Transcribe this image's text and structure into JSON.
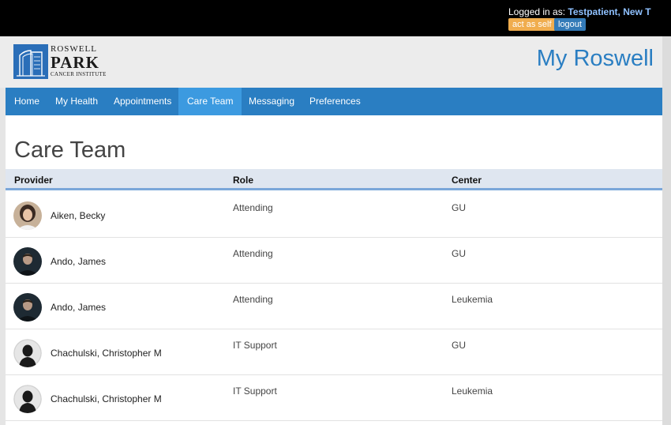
{
  "topbar": {
    "logged_in_label": "Logged in as:",
    "user_name": "Testpatient, New T",
    "act_as_self_label": "act as self",
    "logout_label": "logout"
  },
  "header": {
    "logo_line1": "ROSWELL",
    "logo_line2": "PARK",
    "logo_line3": "CANCER INSTITUTE",
    "site_title": "My Roswell"
  },
  "nav": {
    "items": [
      {
        "label": "Home"
      },
      {
        "label": "My Health"
      },
      {
        "label": "Appointments"
      },
      {
        "label": "Care Team",
        "active": true
      },
      {
        "label": "Messaging"
      },
      {
        "label": "Preferences"
      }
    ]
  },
  "main": {
    "title": "Care Team",
    "columns": [
      "Provider",
      "Role",
      "Center"
    ],
    "rows": [
      {
        "provider": "Aiken, Becky",
        "role": "Attending",
        "center": "GU",
        "avatar": "photo-female"
      },
      {
        "provider": "Ando, James",
        "role": "Attending",
        "center": "GU",
        "avatar": "photo-male"
      },
      {
        "provider": "Ando, James",
        "role": "Attending",
        "center": "Leukemia",
        "avatar": "photo-male"
      },
      {
        "provider": "Chachulski, Christopher M",
        "role": "IT Support",
        "center": "GU",
        "avatar": "silhouette"
      },
      {
        "provider": "Chachulski, Christopher M",
        "role": "IT Support",
        "center": "Leukemia",
        "avatar": "silhouette"
      }
    ]
  },
  "colors": {
    "brand_blue": "#2a7ec2",
    "nav_active": "#3c9ae0",
    "warning_orange": "#f0ad4e",
    "topbar_black": "#000000"
  }
}
